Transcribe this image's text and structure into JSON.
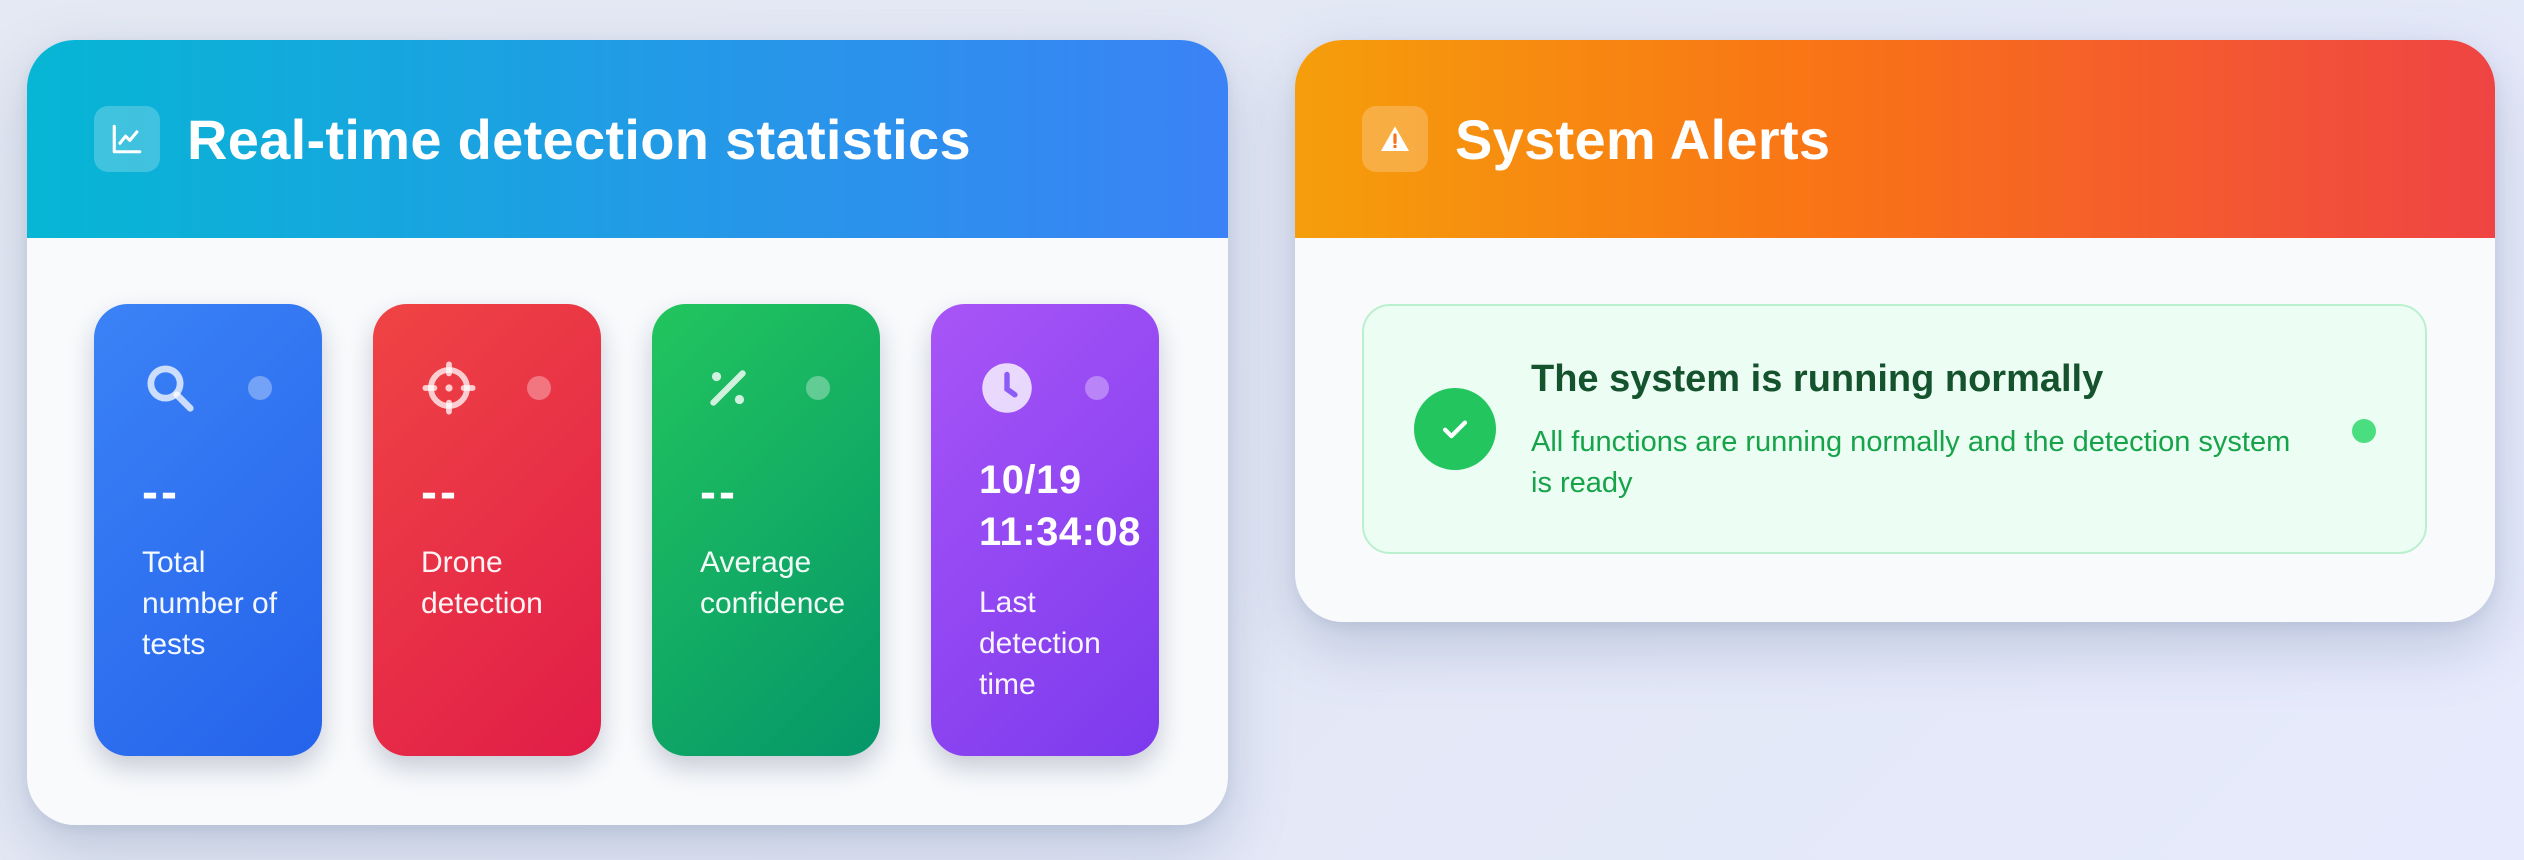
{
  "stats_panel": {
    "title": "Real-time detection statistics",
    "icon": "line-chart-icon",
    "cards": [
      {
        "icon": "search-icon",
        "value": "--",
        "label": "Total number of tests",
        "color": "#3b82f6"
      },
      {
        "icon": "crosshair-icon",
        "value": "--",
        "label": "Drone detection",
        "color": "#ef4444"
      },
      {
        "icon": "percent-icon",
        "value": "--",
        "label": "Average confidence",
        "color": "#22c55e"
      },
      {
        "icon": "clock-icon",
        "value_date": "10/19",
        "value_time": "11:34:08",
        "label": "Last detection time",
        "color": "#a855f7"
      }
    ]
  },
  "alerts_panel": {
    "title": "System Alerts",
    "icon": "warning-icon",
    "alert": {
      "icon": "check-icon",
      "title": "The system is running normally",
      "description": "All functions are running normally and the detection system is ready",
      "status_color": "#22c55e"
    }
  }
}
